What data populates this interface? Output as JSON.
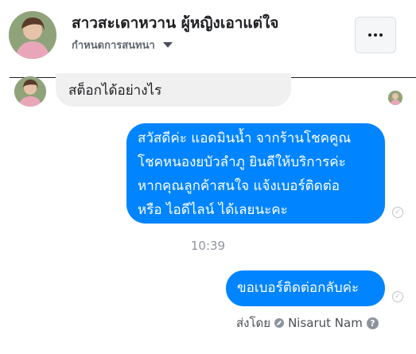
{
  "header": {
    "contact_name": "สาวสะเดาหวาน ผู้หญิงเอาแต่ใจ",
    "assign_label": "กำหนดการสนทนา",
    "more_icon": "ellipsis-icon"
  },
  "messages": {
    "incoming_text": "สต็อกได้อย่างไร",
    "outgoing_1_lines": [
      "สวัสดีค่ะ แอดมินน้ำ จากร้านโชคคูณ",
      "โชคหนองยบัวลำภู ยินดีให้บริการค่ะ",
      "หากคุณลูกค้าสนใจ แจ้งเบอร์ติดต่อ",
      "หรือ ไอดีไลน์ ได้เลยนะคะ"
    ],
    "timestamp": "10:39",
    "outgoing_2_text": "ขอเบอร์ติดต่อกลับค่ะ"
  },
  "footer": {
    "sent_by_label": "ส่งโดย",
    "sender_name": "Nisarut Nam",
    "help_glyph": "?"
  },
  "colors": {
    "accent": "#0084ff",
    "incoming_bubble": "#f1f0f0"
  }
}
